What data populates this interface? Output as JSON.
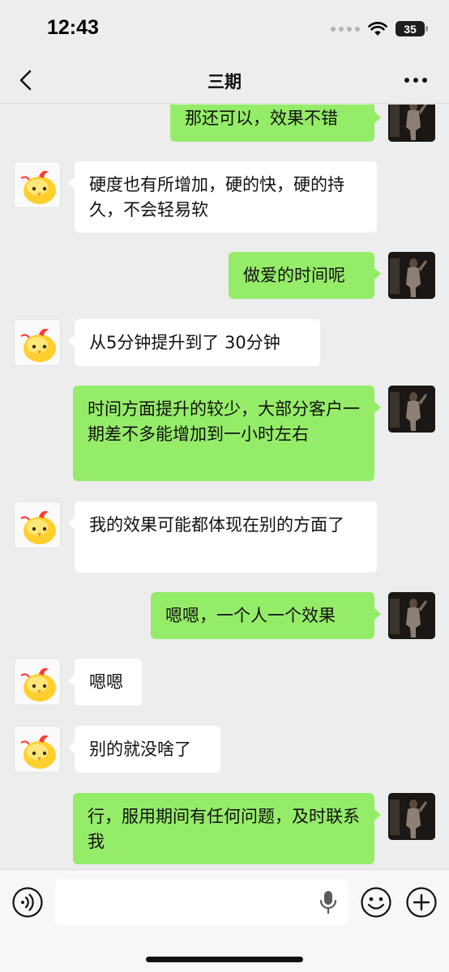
{
  "status_bar": {
    "time": "12:43",
    "battery": "35"
  },
  "nav": {
    "title": "三期"
  },
  "messages": [
    {
      "side": "out",
      "text": "那还可以，效果不错"
    },
    {
      "side": "in",
      "text": "硬度也有所增加，硬的快，硬的持久，不会轻易软"
    },
    {
      "side": "out",
      "text": "做爱的时间呢"
    },
    {
      "side": "in",
      "text": "从5分钟提升到了 30分钟"
    },
    {
      "side": "out",
      "text": "时间方面提升的较少，大部分客户一期差不多能增加到一小时左右"
    },
    {
      "side": "in",
      "text": "我的效果可能都体现在别的方面了"
    },
    {
      "side": "out",
      "text": "嗯嗯，一个人一个效果"
    },
    {
      "side": "in",
      "text": "嗯嗯"
    },
    {
      "side": "in",
      "text": "别的就没啥了"
    },
    {
      "side": "out",
      "text": "行，服用期间有任何问题，及时联系我"
    }
  ],
  "icons": {
    "back": "chevron-left-icon",
    "more": "more-dots-icon",
    "voice": "voice-icon",
    "mic": "mic-icon",
    "emoji": "emoji-icon",
    "plus": "plus-icon"
  },
  "colors": {
    "outgoing_bubble": "#95ec69",
    "incoming_bubble": "#ffffff",
    "background": "#ededed"
  }
}
